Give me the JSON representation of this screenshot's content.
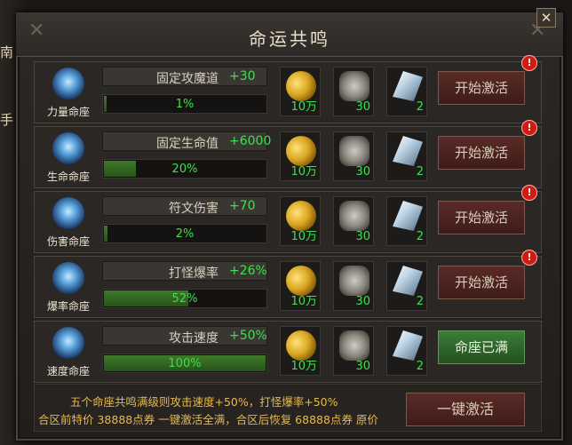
{
  "window": {
    "title": "命运共鸣",
    "close_label": "✕"
  },
  "side_fragments": [
    "南",
    "手"
  ],
  "rows": [
    {
      "icon": "power-constellation-icon",
      "name": "力量命座",
      "stat": "固定攻魔道",
      "bonus": "+30",
      "progress_text": "1%",
      "progress": 0.01,
      "items": [
        {
          "icon": "gold-coins-icon",
          "count": "10万"
        },
        {
          "icon": "ore-icon",
          "count": "30"
        },
        {
          "icon": "crystal-icon",
          "count": "2"
        }
      ],
      "button": "开始激活",
      "alert": "!"
    },
    {
      "icon": "life-constellation-icon",
      "name": "生命命座",
      "stat": "固定生命值",
      "bonus": "+6000",
      "progress_text": "20%",
      "progress": 0.2,
      "items": [
        {
          "icon": "gold-coins-icon",
          "count": "10万"
        },
        {
          "icon": "ore-icon",
          "count": "30"
        },
        {
          "icon": "crystal-icon",
          "count": "2"
        }
      ],
      "button": "开始激活",
      "alert": "!"
    },
    {
      "icon": "damage-constellation-icon",
      "name": "伤害命座",
      "stat": "符文伤害",
      "bonus": "+70",
      "progress_text": "2%",
      "progress": 0.02,
      "items": [
        {
          "icon": "gold-coins-icon",
          "count": "10万"
        },
        {
          "icon": "ore-icon",
          "count": "30"
        },
        {
          "icon": "crystal-icon",
          "count": "2"
        }
      ],
      "button": "开始激活",
      "alert": "!"
    },
    {
      "icon": "crit-rate-constellation-icon",
      "name": "爆率命座",
      "stat": "打怪爆率",
      "bonus": "+26%",
      "progress_text": "52%",
      "progress": 0.52,
      "items": [
        {
          "icon": "gold-coins-icon",
          "count": "10万"
        },
        {
          "icon": "ore-icon",
          "count": "30"
        },
        {
          "icon": "crystal-icon",
          "count": "2"
        }
      ],
      "button": "开始激活",
      "alert": "!"
    },
    {
      "icon": "speed-constellation-icon",
      "name": "速度命座",
      "stat": "攻击速度",
      "bonus": "+50%",
      "progress_text": "100%",
      "progress": 1.0,
      "items": [
        {
          "icon": "gold-coins-icon",
          "count": "10万"
        },
        {
          "icon": "ore-icon",
          "count": "30"
        },
        {
          "icon": "crystal-icon",
          "count": "2"
        }
      ],
      "button": "命座已满",
      "alert": ""
    }
  ],
  "footer": {
    "line1": "五个命座共鸣满级则攻击速度+50%，打怪爆率+50%",
    "line2": "合区前特价 38888点券 一键激活全满，合区后恢复 68888点券 原价",
    "button": "一键激活"
  },
  "colors": {
    "green_text": "#3ee04a",
    "gold_text": "#e8b94a",
    "full_button": "#3c7c3a",
    "activate_button": "#5a2a26",
    "alert": "#d11a12"
  }
}
